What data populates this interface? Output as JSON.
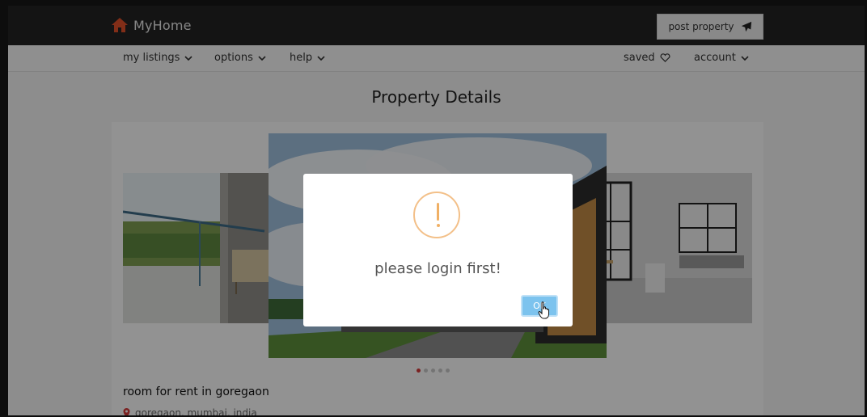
{
  "brand": {
    "name": "MyHome"
  },
  "header": {
    "post_label": "post property"
  },
  "nav": {
    "left": [
      {
        "label": "my listings"
      },
      {
        "label": "options"
      },
      {
        "label": "help"
      }
    ],
    "saved_label": "saved",
    "account_label": "account"
  },
  "page": {
    "title": "Property Details"
  },
  "gallery": {
    "slides_count": 5,
    "active_index": 0
  },
  "listing": {
    "title": "room for rent in goregaon",
    "location": "goregaon, mumbai, india"
  },
  "modal": {
    "message": "please login first!",
    "ok_label": "OK"
  },
  "colors": {
    "brand_icon": "#e0502a",
    "topbar": "#232323",
    "warning": "#f0b065",
    "ok_button": "#7cc3ee",
    "active_dot": "#d53a3a"
  }
}
